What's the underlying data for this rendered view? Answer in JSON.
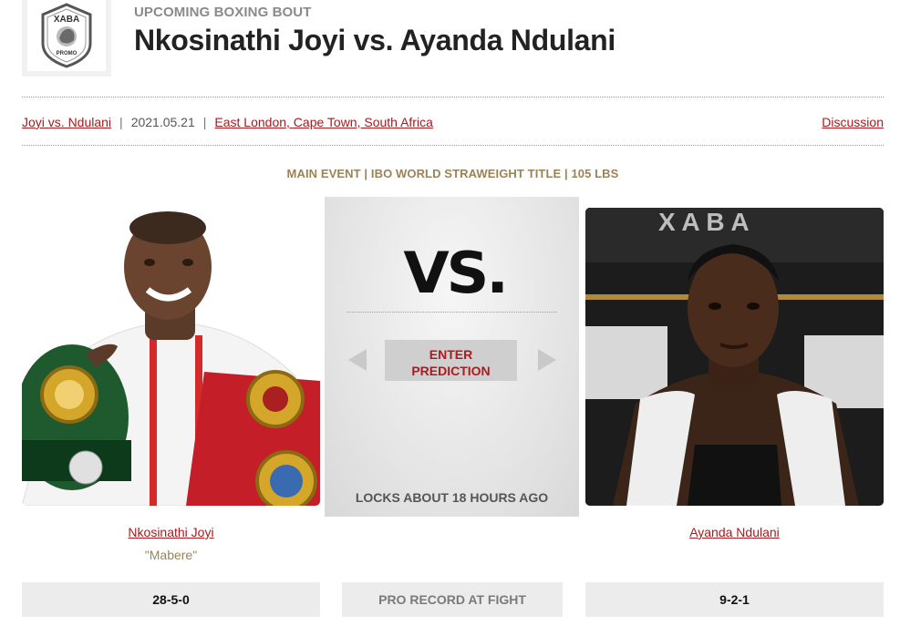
{
  "header": {
    "logo_text_top": "XABA",
    "logo_text_bottom": "PROMO",
    "eyebrow": "UPCOMING BOXING BOUT",
    "title": "Nkosinathi Joyi vs. Ayanda Ndulani"
  },
  "meta": {
    "matchup_link": "Joyi vs. Ndulani",
    "date": "2021.05.21",
    "location_link": "East London, Cape Town, South Africa",
    "separator": "|",
    "discussion_link": "Discussion"
  },
  "event_line": "MAIN EVENT | IBO WORLD STRAWEIGHT TITLE | 105 LBS",
  "center_panel": {
    "vs_label": "VS.",
    "predict_button": "ENTER\nPREDICTION",
    "locks_text": "LOCKS ABOUT 18 HOURS AGO"
  },
  "fighters": {
    "left": {
      "name": "Nkosinathi Joyi",
      "nickname": "\"Mabere\"",
      "record": "28-5-0"
    },
    "right": {
      "name": "Ayanda Ndulani",
      "record": "9-2-1"
    }
  },
  "record_label": "PRO RECORD AT FIGHT",
  "colors": {
    "link_red": "#a8191d",
    "gold": "#9a8356",
    "panel_gray": "#e2e2e2"
  }
}
